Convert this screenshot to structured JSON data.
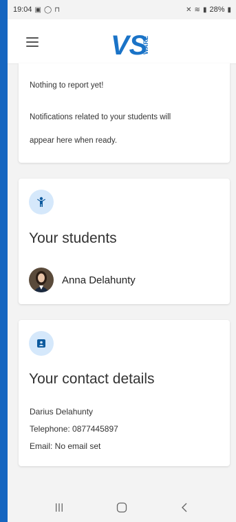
{
  "status_bar": {
    "time": "19:04",
    "battery": "28%"
  },
  "header": {
    "logo_icon": "vsware-logo",
    "logo_letters": "VS",
    "logo_word": "WARE",
    "menu_icon": "hamburger-icon"
  },
  "notifications": {
    "empty_title": "Nothing to report yet!",
    "message_line1": "Notifications related to your students will",
    "message_line2": "appear here when ready."
  },
  "students": {
    "icon": "child-icon",
    "title": "Your students",
    "items": [
      {
        "name": "Anna Delahunty"
      }
    ]
  },
  "contact": {
    "icon": "contact-card-icon",
    "title": "Your contact details",
    "name": "Darius Delahunty",
    "telephone": "Telephone: 0877445897",
    "email": "Email: No email set"
  },
  "colors": {
    "brand": "#1a73c7",
    "icon_bg": "#d5e8fb",
    "outer_bg": "#1565c0"
  },
  "nav_bar": {
    "buttons": [
      "recent-apps-icon",
      "home-icon",
      "back-icon"
    ]
  }
}
